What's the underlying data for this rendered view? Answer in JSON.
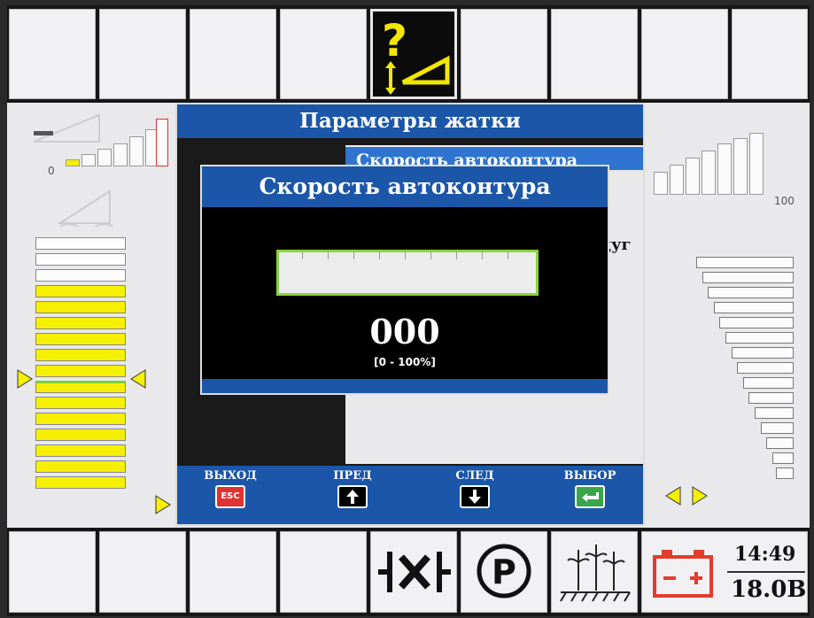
{
  "colors": {
    "accent": "#1b56a9",
    "highlight": "#2f74d0",
    "level_yellow": "#f5f000",
    "input_border": "#8bd33c",
    "battery": "#e53b2b"
  },
  "top_bar": {
    "active_icon": "header-help-icon"
  },
  "left_panel": {
    "scale_min": "0"
  },
  "right_panel": {
    "scale_max": "100"
  },
  "params_dialog": {
    "title": "Параметры жатки",
    "selected_item": "Скорость автоконтура",
    "partial_text": "дуг"
  },
  "autocontour_dialog": {
    "title": "Скорость автоконтура",
    "value": "000",
    "range": "[0 - 100%]",
    "progress": 0
  },
  "footer": {
    "exit_label": "ВЫХОД",
    "exit_key": "ESC",
    "prev_label": "ПРЕД",
    "next_label": "СЛЕД",
    "select_label": "ВЫБОР"
  },
  "status": {
    "time": "14:49",
    "voltage": "18.0В"
  },
  "bottom_bar": {
    "icons": [
      "cross-arrow-icon",
      "parking-icon",
      "crop-field-icon",
      "battery-icon"
    ]
  }
}
